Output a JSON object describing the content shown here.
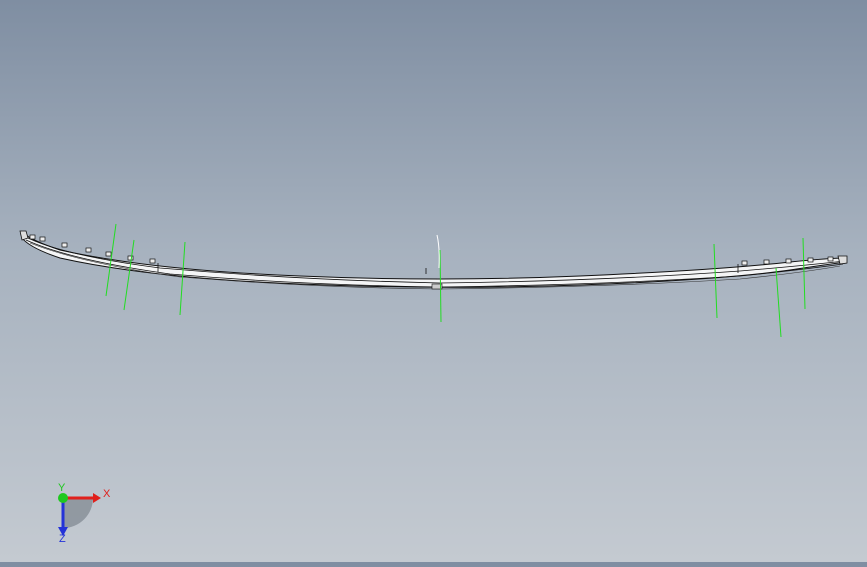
{
  "viewport": {
    "background_top": "#7f8ea2",
    "background_bottom": "#c4cad1"
  },
  "model": {
    "edge_color": "#111111",
    "body_color": "#f4f5f6",
    "reference_axis_color": "#22dd22"
  },
  "triad": {
    "x_label": "X",
    "y_label": "Y",
    "z_label": "Z",
    "x_color": "#e0201c",
    "y_color": "#1ec81e",
    "z_color": "#2433d8"
  }
}
